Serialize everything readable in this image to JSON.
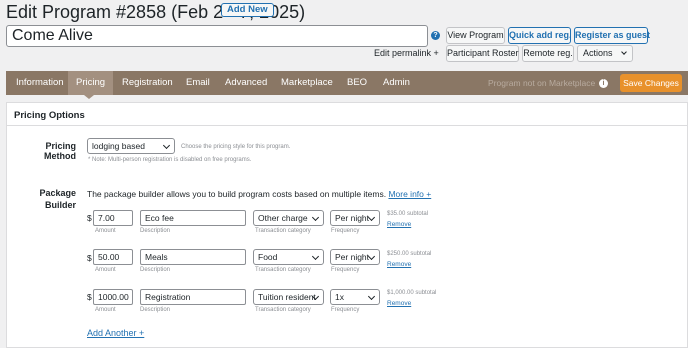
{
  "header": {
    "title": "Edit Program #2858 (Feb 2 - 7, 2025)",
    "add_new_label": "Add New",
    "program_name": "Come Alive",
    "edit_permalink": "Edit permalink +"
  },
  "actions": {
    "view_program": "View Program",
    "quick_add_reg": "Quick add reg.",
    "register_as_guest": "Register as guest",
    "participant_roster": "Participant Roster",
    "remote_reg": "Remote reg.",
    "actions": "Actions"
  },
  "tabs": [
    {
      "label": "Information"
    },
    {
      "label": "Pricing"
    },
    {
      "label": "Registration"
    },
    {
      "label": "Email"
    },
    {
      "label": "Advanced"
    },
    {
      "label": "Marketplace"
    },
    {
      "label": "BEO"
    },
    {
      "label": "Admin"
    }
  ],
  "active_tab": "Pricing",
  "marketplace_status": "Program not on Marketplace",
  "save_label": "Save Changes",
  "pricing": {
    "section_title": "Pricing Options",
    "method_label": "Pricing Method",
    "method_value": "lodging based",
    "method_hint": "Choose the pricing style for this program.",
    "method_note": "* Note: Multi-person registration is disabled on free programs.",
    "package_label_1": "Package",
    "package_label_2": "Builder",
    "package_desc": "The package builder allows you to build program costs based on multiple items.",
    "more_info": "More info +",
    "currency": "$",
    "amount_hint": "Amount",
    "description_hint": "Description",
    "category_hint": "Transaction category",
    "frequency_hint": "Frequency",
    "remove_label": "Remove",
    "add_another": "Add Another +",
    "items": [
      {
        "amount": "7.00",
        "description": "Eco fee",
        "category": "Other charge",
        "frequency": "Per night",
        "subtotal": "$35.00 subtotal"
      },
      {
        "amount": "50.00",
        "description": "Meals",
        "category": "Food",
        "frequency": "Per night",
        "subtotal": "$250.00 subtotal"
      },
      {
        "amount": "1000.00",
        "description": "Registration",
        "category": "Tuition resident",
        "frequency": "1x",
        "subtotal": "$1,000.00 subtotal"
      }
    ]
  },
  "colors": {
    "tab_bar": "#8a7765",
    "active_tab": "#a39080",
    "save_button": "#e8912b",
    "link": "#2271b1"
  }
}
